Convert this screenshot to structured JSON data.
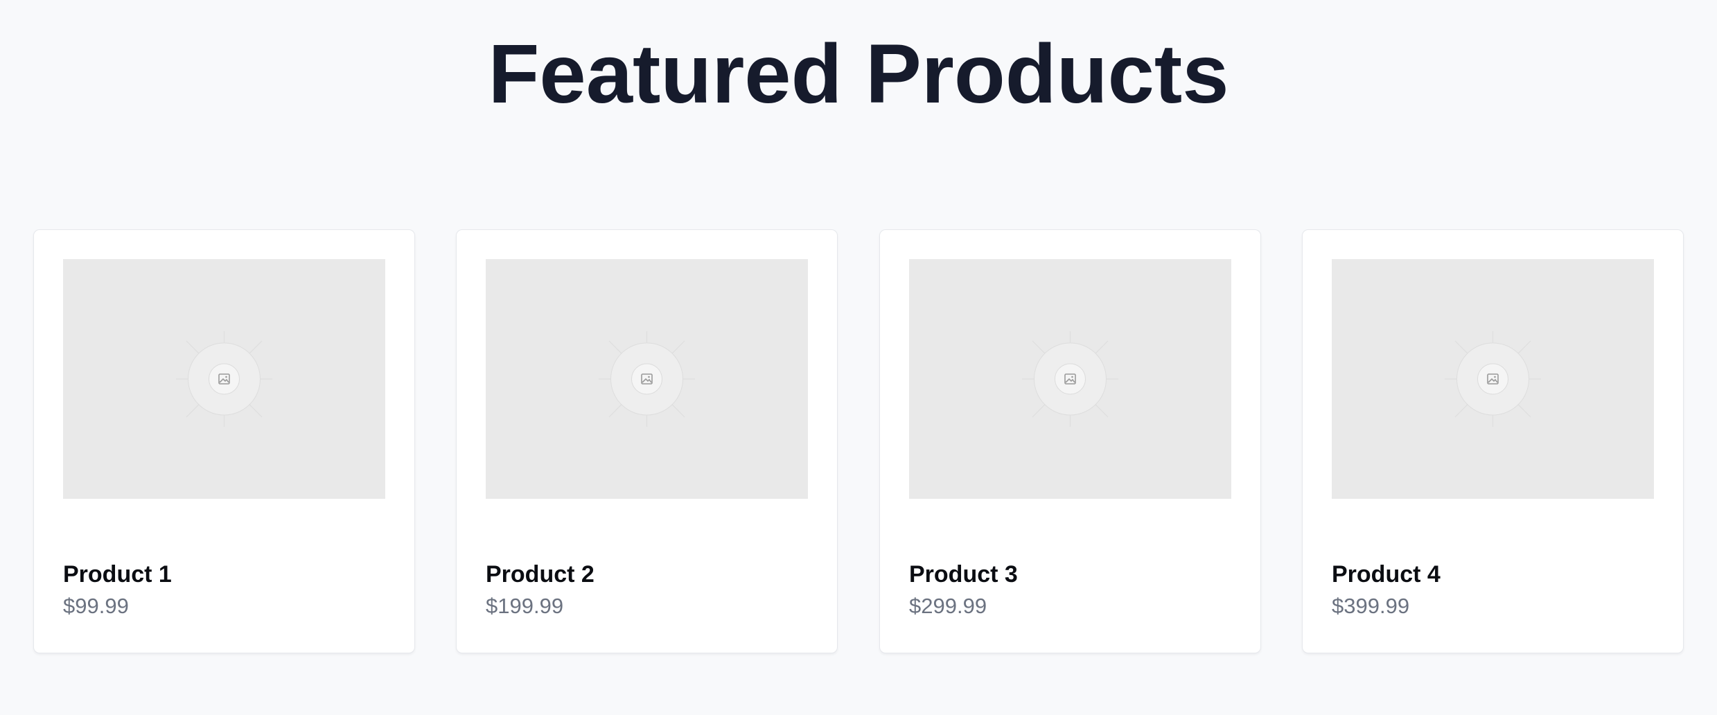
{
  "page": {
    "title": "Featured Products"
  },
  "products": [
    {
      "name": "Product 1",
      "price": "$99.99",
      "image_icon": "image-placeholder-icon"
    },
    {
      "name": "Product 2",
      "price": "$199.99",
      "image_icon": "image-placeholder-icon"
    },
    {
      "name": "Product 3",
      "price": "$299.99",
      "image_icon": "image-placeholder-icon"
    },
    {
      "name": "Product 4",
      "price": "$399.99",
      "image_icon": "image-placeholder-icon"
    }
  ],
  "colors": {
    "background": "#f8f9fb",
    "card_background": "#ffffff",
    "title_text": "#161b2c",
    "product_name_text": "#0b0d12",
    "price_text": "#6b7280",
    "image_placeholder": "#e9e9e9"
  }
}
